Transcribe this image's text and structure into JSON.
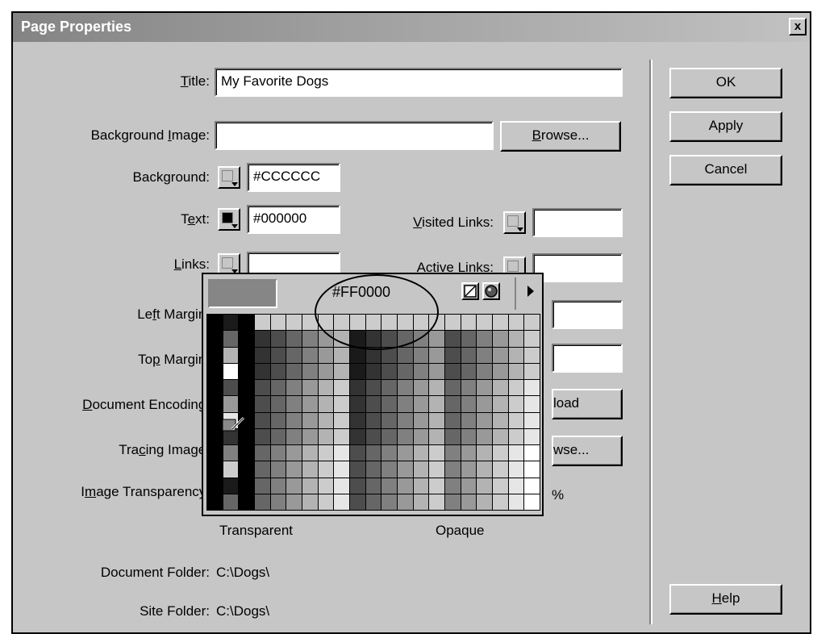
{
  "dialog": {
    "title": "Page Properties",
    "close_label": "x"
  },
  "fields": {
    "title_label": "Title:",
    "title_value": "My Favorite Dogs",
    "bgimage_label": "Background Image:",
    "bgimage_value": "",
    "background_label": "Background:",
    "background_value": "#CCCCCC",
    "text_label": "Text:",
    "text_value": "#000000",
    "visited_label": "Visited Links:",
    "visited_value": "",
    "links_label": "Links:",
    "links_value": "",
    "active_label": "Active Links:",
    "active_value": "",
    "left_margin_label": "Left Margin:",
    "top_margin_label": "Top Margin:",
    "encoding_label": "Document Encoding:",
    "tracing_label": "Tracing Image:",
    "transparency_label": "Image Transparency:",
    "transparent_label": "Transparent",
    "opaque_label": "Opaque",
    "percent": "%",
    "doc_folder_label": "Document Folder:",
    "doc_folder_value": "C:\\Dogs\\",
    "site_folder_label": "Site Folder:",
    "site_folder_value": "C:\\Dogs\\"
  },
  "buttons": {
    "browse1": "Browse...",
    "reload_partial": "load",
    "browse2_partial": "wse...",
    "ok": "OK",
    "apply": "Apply",
    "cancel": "Cancel",
    "help": "Help"
  },
  "picker": {
    "hex": "#FF0000"
  },
  "colors": {
    "dialog_bg": "#c6c6c6",
    "title_bar": "#848484",
    "text_swatch": "#000000"
  }
}
